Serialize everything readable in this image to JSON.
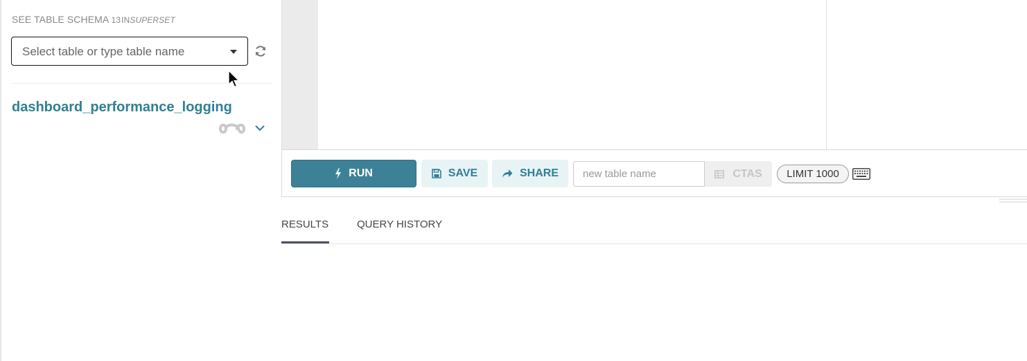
{
  "left_panel": {
    "schema_label": "SEE TABLE SCHEMA",
    "schema_count": "13",
    "schema_in": "IN",
    "database_name": "SUPERSET",
    "table_select_placeholder": "Select table or type table name",
    "selected_table": "dashboard_performance_logging"
  },
  "toolbar": {
    "run_label": "RUN",
    "save_label": "SAVE",
    "share_label": "SHARE",
    "new_table_placeholder": "new table name",
    "ctas_label": "CTAS",
    "limit_label": "LIMIT 1000"
  },
  "results": {
    "tabs": [
      {
        "label": "RESULTS",
        "active": true
      },
      {
        "label": "QUERY HISTORY",
        "active": false
      }
    ]
  },
  "colors": {
    "accent": "#3d8199",
    "link": "#2f7f96",
    "tab_underline": "#484f69",
    "gutter": "#ebebeb"
  },
  "icons": {
    "caret": "caret-down-icon",
    "refresh": "refresh-icon",
    "loading": "loading-icon",
    "chevron": "chevron-down-icon",
    "run": "bolt-icon",
    "save": "floppy-disk-icon",
    "share": "share-arrow-icon",
    "ctas": "table-icon",
    "keyboard": "keyboard-icon",
    "cursor": "mouse-pointer-icon"
  }
}
